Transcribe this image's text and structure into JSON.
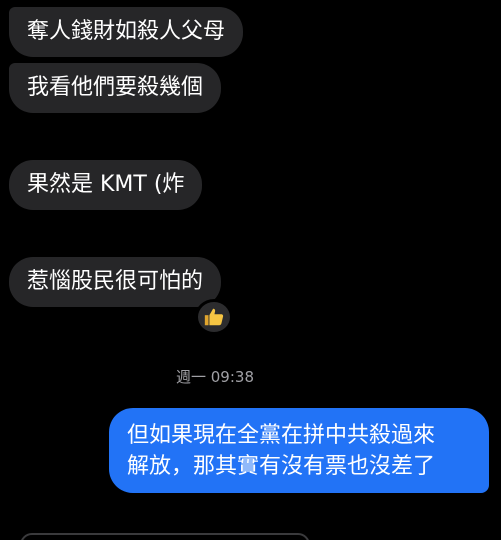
{
  "messages_in": [
    {
      "text": "奪人錢財如殺人父母"
    },
    {
      "text": "我看他們要殺幾個"
    },
    {
      "text": "果然是 KMT (炸"
    },
    {
      "text": "惹惱股民很可怕的"
    }
  ],
  "reaction": {
    "icon": "thumbs-up-icon",
    "color": "#f6c543"
  },
  "timestamp": "週一 09:38",
  "message_out": {
    "text": "但如果現在全黨在拼中共殺過來\n解放，那其實有沒有票也沒差了"
  },
  "colors": {
    "background": "#000000",
    "incoming_bubble": "#262628",
    "outgoing_bubble": "#2273f6",
    "timestamp": "#a0a0a5"
  }
}
